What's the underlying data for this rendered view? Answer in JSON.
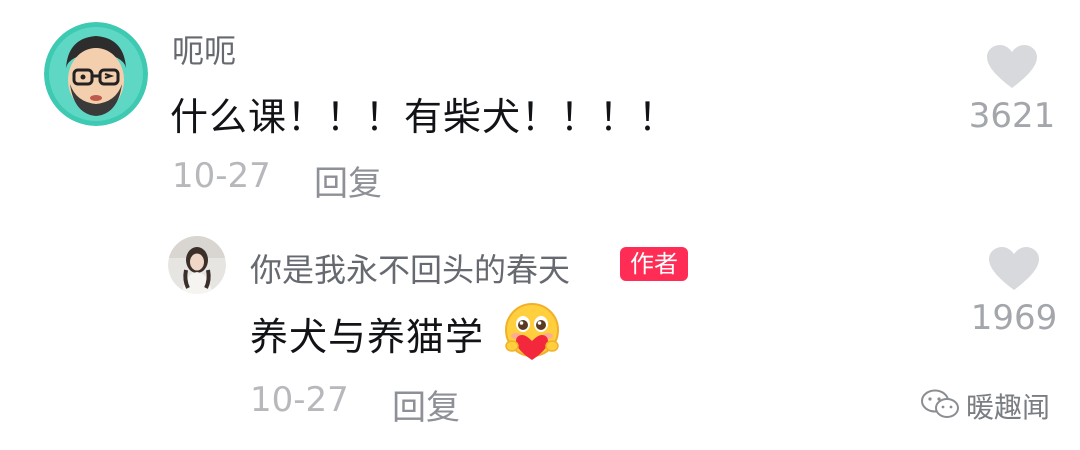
{
  "colors": {
    "username": "#666a70",
    "content": "#111317",
    "date": "#b6b8bc",
    "reply": "#8d9096",
    "like_icon": "#d7d9dc",
    "author_badge_bg": "#ff2c55",
    "author_badge_text": "#ffffff"
  },
  "comment": {
    "username": "呃呃",
    "text": "什么课！！！有柴犬！！！！",
    "date": "10-27",
    "reply_label": "回复",
    "like_icon": "heart-icon",
    "like_count": "3621"
  },
  "reply": {
    "username": "你是我永不回头的春天",
    "author_badge": "作者",
    "text": "养犬与养猫学",
    "emoji": "heart-hug-emoji",
    "date": "10-27",
    "reply_label": "回复",
    "like_icon": "heart-icon",
    "like_count": "1969"
  },
  "watermark": {
    "icon": "wechat-icon",
    "text": "暖趣闻"
  }
}
